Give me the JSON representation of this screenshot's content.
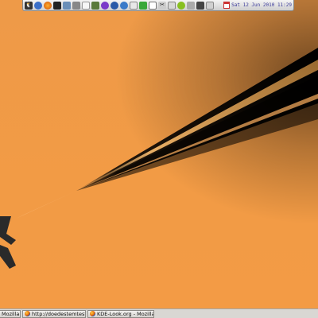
{
  "colors": {
    "desktop_orange": "#f29b45",
    "beam_dark": "#000000",
    "panel_bg": "#e4e4e4",
    "taskbar_bg": "#d9d7d3"
  },
  "top_panel": {
    "launchers": [
      {
        "icon": "penguin-icon"
      },
      {
        "icon": "globe-icon"
      },
      {
        "icon": "firefox-icon"
      },
      {
        "icon": "terminal-icon"
      },
      {
        "icon": "file-manager-icon"
      },
      {
        "icon": "settings-icon"
      },
      {
        "icon": "text-editor-icon"
      },
      {
        "icon": "monitor-icon"
      },
      {
        "icon": "chat-icon"
      },
      {
        "icon": "network-icon"
      },
      {
        "icon": "browser-icon"
      },
      {
        "icon": "mail-icon"
      },
      {
        "icon": "tree-icon"
      },
      {
        "icon": "document-icon"
      },
      {
        "icon": "scissors-icon"
      },
      {
        "icon": "image-icon"
      },
      {
        "icon": "package-icon"
      },
      {
        "icon": "wrench-icon"
      },
      {
        "icon": "camera-icon"
      },
      {
        "icon": "clipboard-icon"
      }
    ],
    "tray_text": "Sat 12 Jun 2010 11:29"
  },
  "taskbar": {
    "tasks": [
      {
        "label": "Mozilla Fire"
      },
      {
        "label": "http://doedestemtest.sata"
      },
      {
        "label": "KDE-Look.org - Mozilla Fire"
      }
    ]
  }
}
